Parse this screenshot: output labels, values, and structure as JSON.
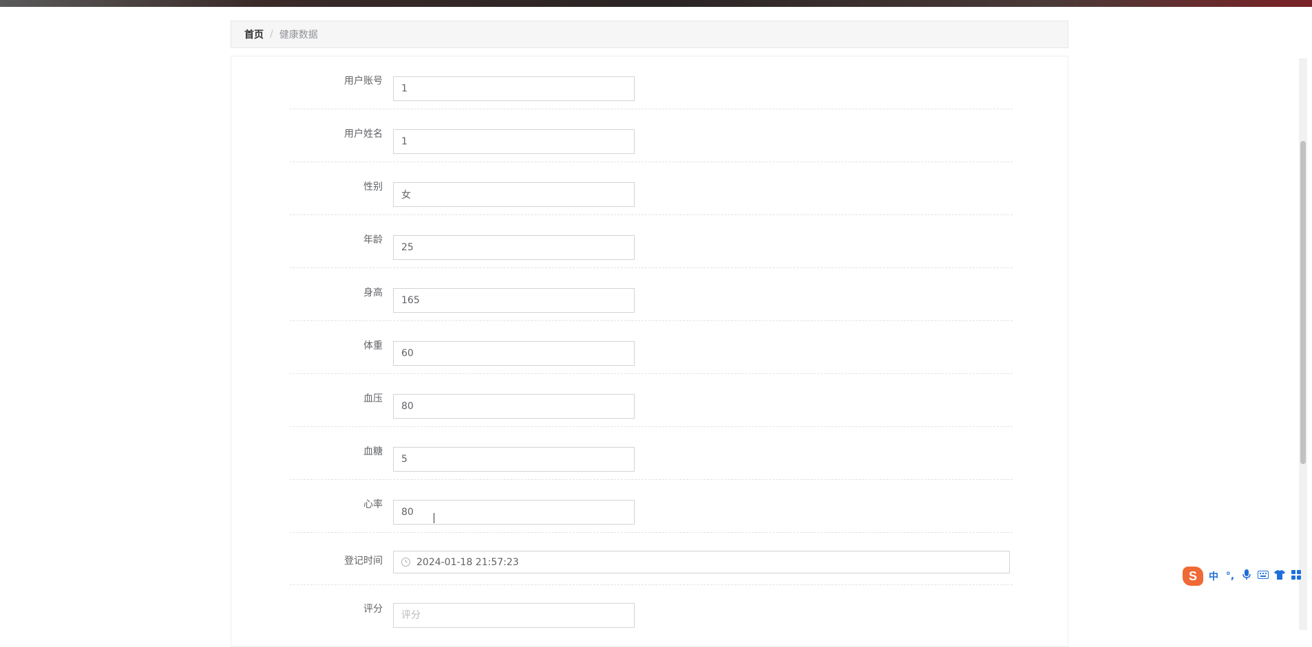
{
  "breadcrumb": {
    "home": "首页",
    "separator": "/",
    "current": "健康数据"
  },
  "form": {
    "fields": [
      {
        "label": "用户账号",
        "value": "1"
      },
      {
        "label": "用户姓名",
        "value": "1"
      },
      {
        "label": "性别",
        "value": "女"
      },
      {
        "label": "年龄",
        "value": "25"
      },
      {
        "label": "身高",
        "value": "165"
      },
      {
        "label": "体重",
        "value": "60"
      },
      {
        "label": "血压",
        "value": "80"
      },
      {
        "label": "血糖",
        "value": "5"
      },
      {
        "label": "心率",
        "value": "80"
      }
    ],
    "register_time": {
      "label": "登记时间",
      "value": "2024-01-18 21:57:23",
      "icon": "clock-icon"
    },
    "score": {
      "label": "评分",
      "value": "",
      "placeholder": "评分"
    }
  },
  "ime_toolbar": {
    "logo": "S",
    "mode": "中",
    "punct": "°,",
    "icons": [
      "mic-icon",
      "keyboard-icon",
      "shirt-icon",
      "grid-icon"
    ]
  },
  "colors": {
    "ime_accent": "#1e6fd9",
    "ime_logo": "#f06a35"
  }
}
